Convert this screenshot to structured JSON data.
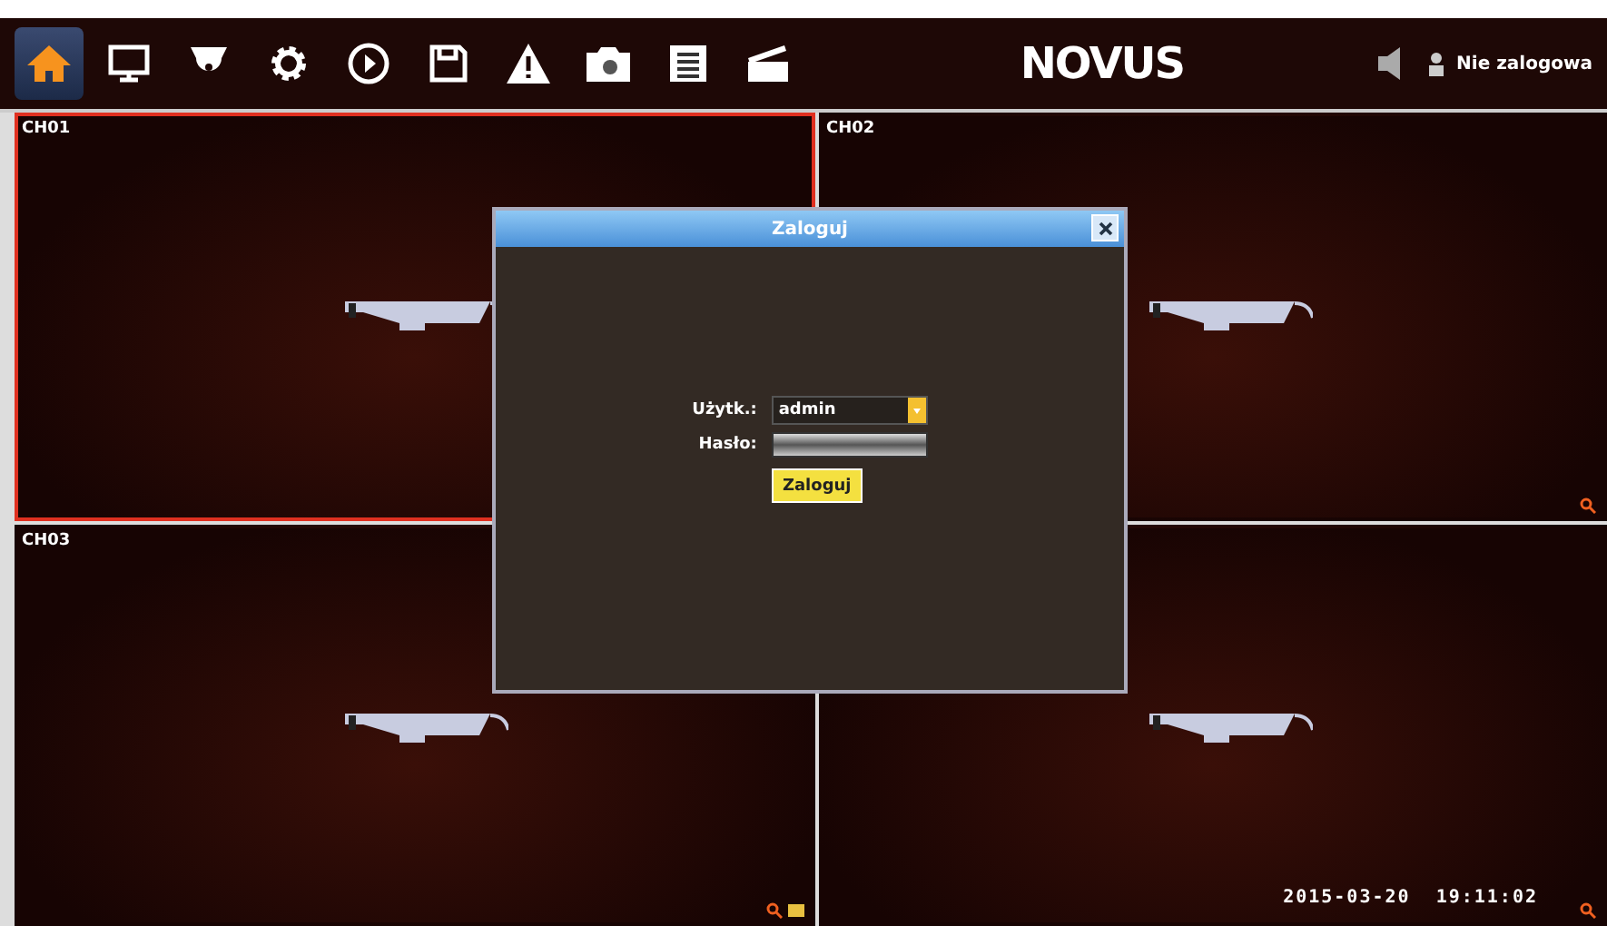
{
  "toolbar": {
    "buttons": [
      {
        "kind": "home",
        "selected": true
      },
      {
        "kind": "monitor",
        "selected": false
      },
      {
        "kind": "dome",
        "selected": false
      },
      {
        "kind": "gear",
        "selected": false
      },
      {
        "kind": "play",
        "selected": false
      },
      {
        "kind": "floppy",
        "selected": false
      },
      {
        "kind": "warning",
        "selected": false
      },
      {
        "kind": "camera",
        "selected": false
      },
      {
        "kind": "list",
        "selected": false
      },
      {
        "kind": "clapper",
        "selected": false
      }
    ],
    "logo": "NOVUS",
    "status": "Nie zalogowa"
  },
  "channels": [
    {
      "label": "CH01",
      "selected": true,
      "zoom_icon": false,
      "folder_icon": false
    },
    {
      "label": "CH02",
      "selected": false,
      "zoom_icon": true,
      "folder_icon": false
    },
    {
      "label": "CH03",
      "selected": false,
      "zoom_icon": true,
      "folder_icon": true
    },
    {
      "selected": false,
      "zoom_icon": true,
      "folder_icon": false,
      "timestamp": "2015-03-20  19:11:02"
    }
  ],
  "dialog": {
    "title": "Zaloguj",
    "user_label": "Użytk.:",
    "user_value": "admin",
    "password_label": "Hasło:",
    "button": "Zaloguj"
  }
}
